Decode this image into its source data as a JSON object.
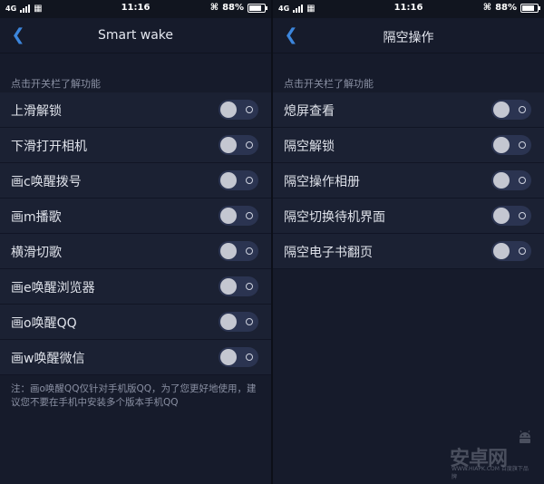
{
  "status": {
    "carrier": "4G",
    "time": "11:16",
    "battery": "88%"
  },
  "left": {
    "title": "Smart wake",
    "section_label": "点击开关栏了解功能",
    "items": [
      {
        "label": "上滑解锁",
        "on": false
      },
      {
        "label": "下滑打开相机",
        "on": false
      },
      {
        "label": "画c唤醒拨号",
        "on": false
      },
      {
        "label": "画m播歌",
        "on": false
      },
      {
        "label": "横滑切歌",
        "on": false
      },
      {
        "label": "画e唤醒浏览器",
        "on": false
      },
      {
        "label": "画o唤醒QQ",
        "on": false
      },
      {
        "label": "画w唤醒微信",
        "on": false
      }
    ],
    "note": "注：画o唤醒QQ仅针对手机版QQ，为了您更好地使用，建议您不要在手机中安装多个版本手机QQ"
  },
  "right": {
    "title": "隔空操作",
    "section_label": "点击开关栏了解功能",
    "items": [
      {
        "label": "熄屏查看",
        "on": false
      },
      {
        "label": "隔空解锁",
        "on": false
      },
      {
        "label": "隔空操作相册",
        "on": false
      },
      {
        "label": "隔空切换待机界面",
        "on": false
      },
      {
        "label": "隔空电子书翻页",
        "on": false
      }
    ]
  },
  "watermark": {
    "brand": "安卓网",
    "url": "WWW.HIAPK.COM",
    "tagline": "百度旗下品牌"
  },
  "colors": {
    "background": "#161b2b",
    "row": "#1b2133",
    "accent": "#3c86dc",
    "toggle_track": "#2b3451",
    "toggle_knob": "#c4c7d1"
  }
}
